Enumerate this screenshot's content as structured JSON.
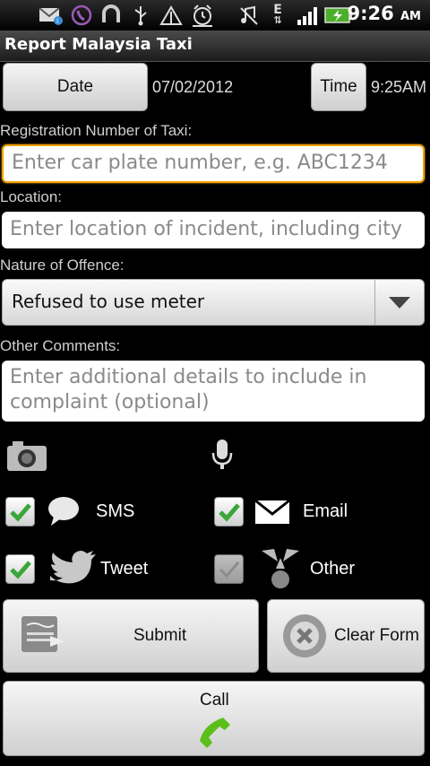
{
  "status_bar": {
    "time": "9:26",
    "ampm": "AM",
    "icons": [
      "mail-notification-icon",
      "phone-icon",
      "sync-icon",
      "usb-icon",
      "wifi-hotspot-icon",
      "alarm-icon",
      "mute-icon",
      "network-e-icon",
      "signal-icon",
      "battery-charging-icon"
    ]
  },
  "app": {
    "title": "Report Malaysia Taxi"
  },
  "datetime": {
    "date_button": "Date",
    "date_value": "07/02/2012",
    "time_button": "Time",
    "time_value": "9:25AM"
  },
  "form": {
    "registration_label": "Registration Number of Taxi:",
    "registration_placeholder": "Enter car plate number, e.g. ABC1234",
    "location_label": "Location:",
    "location_placeholder": "Enter location of incident, including city",
    "offence_label": "Nature of Offence:",
    "offence_selected": "Refused to use meter",
    "comments_label": "Other Comments:",
    "comments_placeholder": "Enter additional details to include in complaint (optional)"
  },
  "options": {
    "sms": {
      "label": "SMS",
      "checked": true
    },
    "email": {
      "label": "Email",
      "checked": true
    },
    "tweet": {
      "label": "Tweet",
      "checked": true
    },
    "other": {
      "label": "Other",
      "checked": false
    }
  },
  "actions": {
    "submit_label": "Submit",
    "clear_label": "Clear Form",
    "call_label": "Call"
  },
  "colors": {
    "focus_border": "#f2a400",
    "check_green": "#3aa63a",
    "call_green": "#5bbf1a"
  }
}
